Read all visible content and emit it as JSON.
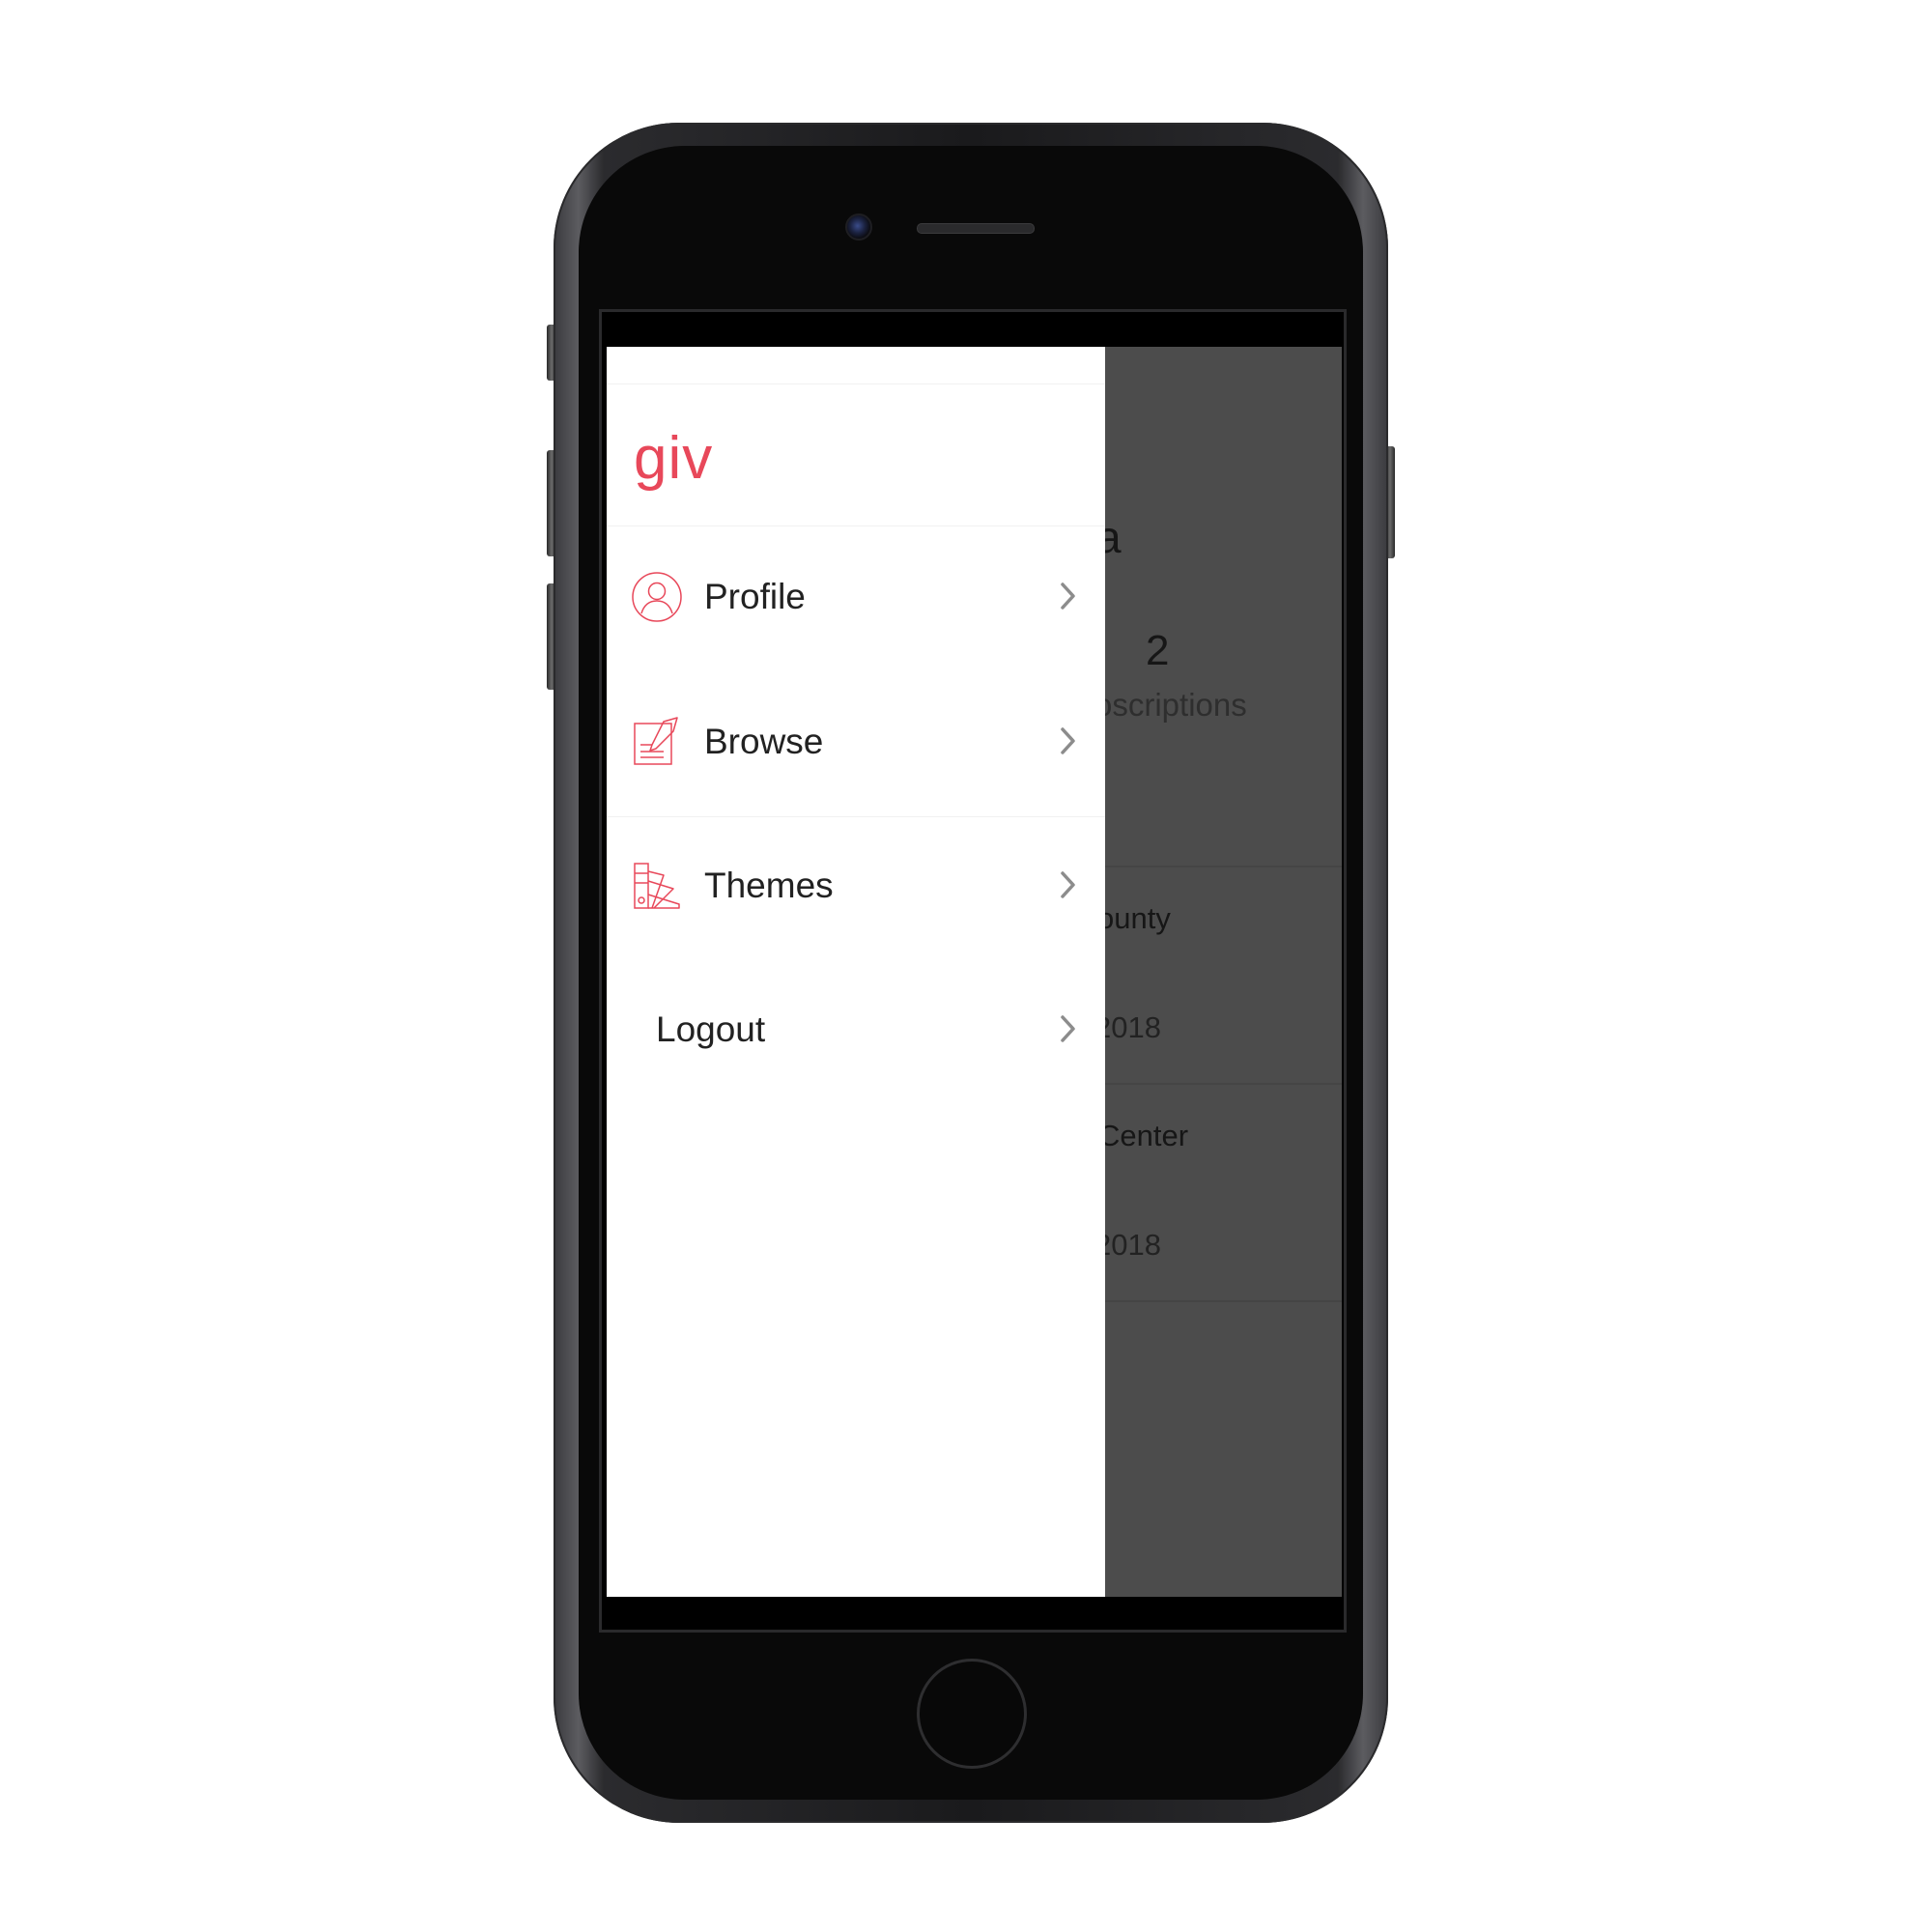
{
  "app": {
    "logo": "giv",
    "accent_color": "#e8485a"
  },
  "drawer": {
    "items": [
      {
        "label": "Profile",
        "icon": "user-circle-icon"
      },
      {
        "label": "Browse",
        "icon": "edit-document-icon"
      },
      {
        "label": "Themes",
        "icon": "color-swatch-icon"
      },
      {
        "label": "Logout",
        "icon": ""
      }
    ]
  },
  "background_screen": {
    "name_fragment": "a",
    "count": "2",
    "count_label_fragment": "oscriptions",
    "rows": [
      {
        "title_fragment": "ounty",
        "date_fragment": "2018"
      },
      {
        "title_fragment": "Center",
        "date_fragment": "2018"
      }
    ]
  }
}
